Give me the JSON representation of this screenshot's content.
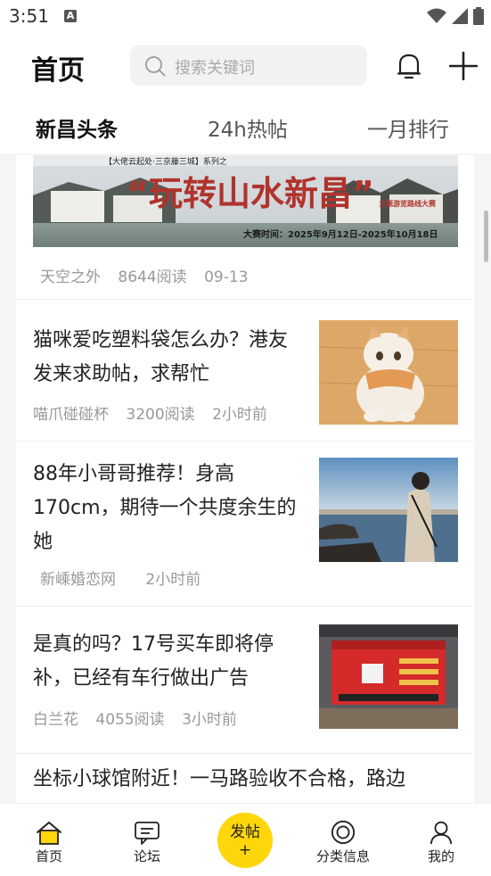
{
  "status_bar": {
    "time": "3:51",
    "notif_letter": "A"
  },
  "header": {
    "title": "首页",
    "search_placeholder": "搜索关键词"
  },
  "tabs": [
    {
      "label": "新昌头条",
      "active": true
    },
    {
      "label": "24h热帖",
      "active": false
    },
    {
      "label": "一月排行",
      "active": false
    }
  ],
  "feed": {
    "banner": {
      "headline": "“玩转山水新昌”",
      "series": "【大佬云起处·三京藤三城】系列之",
      "subtitle": "主题游览路线大赛",
      "dates": "大赛时间：2025年9月12日-2025年10月18日",
      "author": "天空之外",
      "reads": "8644阅读",
      "time": "09-13"
    },
    "posts": [
      {
        "title": "猫咪爱吃塑料袋怎么办？港友发来求助帖，求帮忙",
        "author": "喵爪碰碰杯",
        "reads": "3200阅读",
        "time": "2小时前",
        "thumb": "cat-photo"
      },
      {
        "title": "88年小哥哥推荐！身高170cm，期待一个共度余生的她",
        "author": "新嵊婚恋网",
        "reads": "",
        "time": "2小时前",
        "thumb": "seaside-man-photo"
      },
      {
        "title": "是真的吗？17号买车即将停补，已经有车行做出广告",
        "author": "白兰花",
        "reads": "4055阅读",
        "time": "3小时前",
        "thumb": "car-showroom-photo"
      },
      {
        "title": "坐标小球馆附近！一马路验收不合格，路边",
        "author": "",
        "reads": "",
        "time": ""
      }
    ]
  },
  "bottom_nav": {
    "items": [
      {
        "label": "首页",
        "icon": "home-icon",
        "active": true
      },
      {
        "label": "论坛",
        "icon": "forum-icon",
        "active": false
      },
      {
        "label": "分类信息",
        "icon": "category-icon",
        "active": false
      },
      {
        "label": "我的",
        "icon": "profile-icon",
        "active": false
      }
    ],
    "post_button": {
      "label": "发帖",
      "symbol": "+"
    }
  },
  "colors": {
    "accent": "#ffd60a",
    "text": "#222222",
    "meta": "#999999"
  }
}
